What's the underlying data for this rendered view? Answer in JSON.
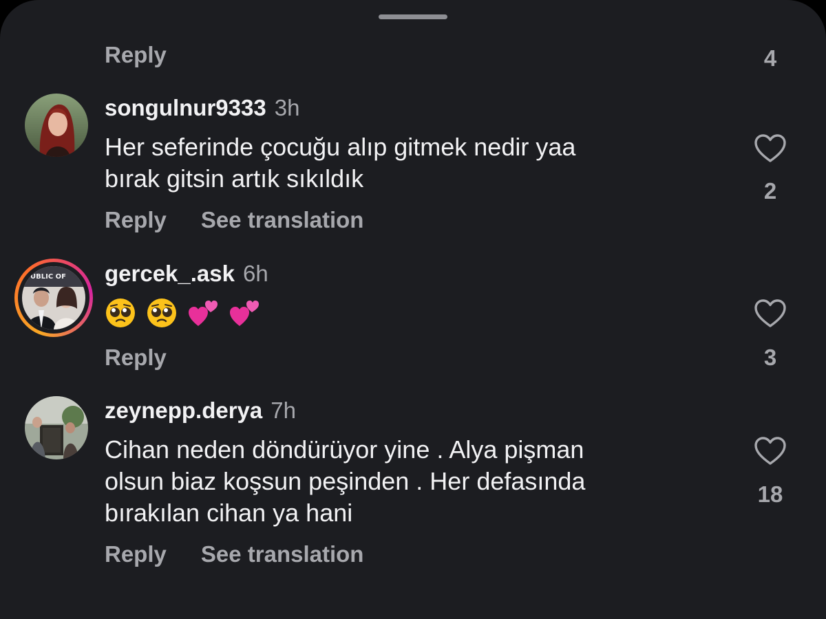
{
  "top_row": {
    "reply_label": "Reply",
    "like_count": "4"
  },
  "comments": [
    {
      "username": "songulnur9333",
      "time": "3h",
      "lines": [
        "Her seferinde çocuğu alıp gitmek nedir yaa",
        "bırak gitsin artık sıkıldık"
      ],
      "reply_label": "Reply",
      "translate_label": "See translation",
      "like_count": "2"
    },
    {
      "username": "gercek_.ask",
      "time": "6h",
      "emojis": [
        "pleading-face",
        "pleading-face",
        "two-hearts",
        "two-hearts"
      ],
      "avatar_text": "UBLIC OF",
      "reply_label": "Reply",
      "like_count": "3"
    },
    {
      "username": "zeynepp.derya",
      "time": "7h",
      "lines": [
        "Cihan neden döndürüyor yine . Alya pişman",
        "olsun biaz koşsun peşinden . Her defasında",
        "bırakılan cihan ya hani"
      ],
      "reply_label": "Reply",
      "translate_label": "See translation",
      "like_count": "18"
    }
  ],
  "colors": {
    "background": "#1c1d21",
    "text_primary": "#f2f2f4",
    "text_secondary": "#a7a8ad",
    "story_ring_start": "#f9a825",
    "story_ring_end": "#d6249f"
  }
}
